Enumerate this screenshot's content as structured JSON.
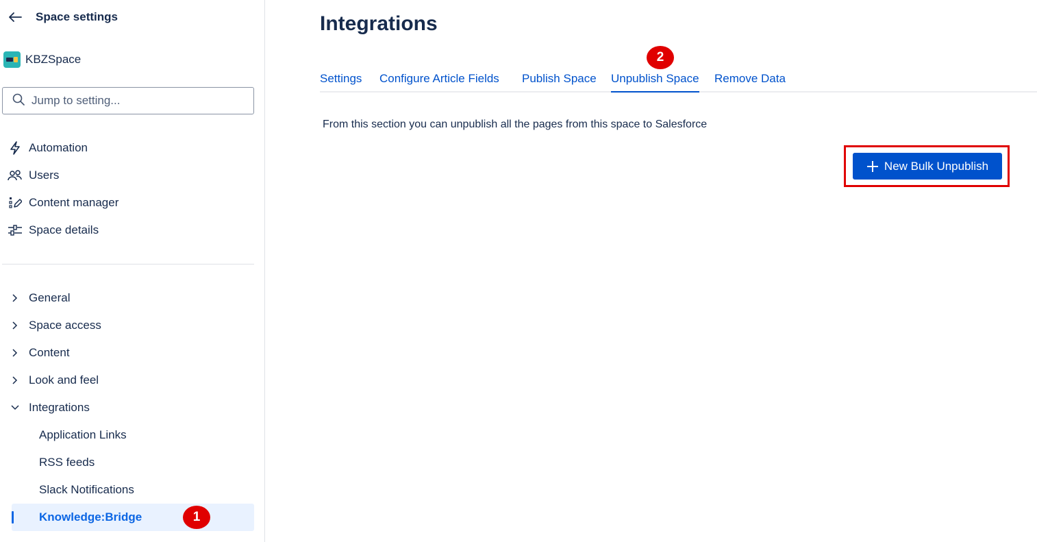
{
  "sidebar": {
    "title": "Space settings",
    "space_name": "KBZSpace",
    "search_placeholder": "Jump to setting...",
    "nav": [
      {
        "label": "Automation",
        "icon": "lightning-icon"
      },
      {
        "label": "Users",
        "icon": "users-icon"
      },
      {
        "label": "Content manager",
        "icon": "content-manager-icon"
      },
      {
        "label": "Space details",
        "icon": "sliders-icon"
      }
    ],
    "tree": [
      {
        "label": "General",
        "expanded": false
      },
      {
        "label": "Space access",
        "expanded": false
      },
      {
        "label": "Content",
        "expanded": false
      },
      {
        "label": "Look and feel",
        "expanded": false
      },
      {
        "label": "Integrations",
        "expanded": true
      }
    ],
    "integrations_children": [
      "Application Links",
      "RSS feeds",
      "Slack Notifications",
      "Knowledge:Bridge"
    ],
    "active_child": "Knowledge:Bridge"
  },
  "annotations": {
    "step1": "1",
    "step2": "2",
    "badge_color": "#e00000"
  },
  "main": {
    "title": "Integrations",
    "tabs": [
      {
        "label": "Settings",
        "active": false
      },
      {
        "label": "Configure Article Fields",
        "active": false
      },
      {
        "label": "Publish Space",
        "active": false
      },
      {
        "label": "Unpublish Space",
        "active": true
      },
      {
        "label": "Remove Data",
        "active": false
      }
    ],
    "description": "From this section you can unpublish all the pages from this space to Salesforce",
    "primary_button": "New Bulk Unpublish"
  },
  "colors": {
    "accent": "#0052cc",
    "active_bg": "#e9f2ff",
    "highlight": "#e00000"
  }
}
